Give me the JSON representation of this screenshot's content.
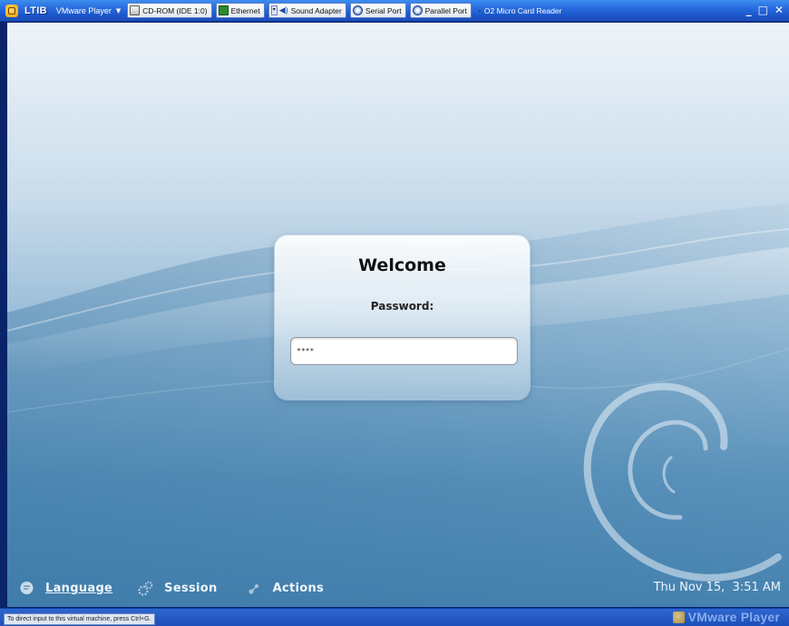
{
  "titlebar": {
    "title": "LTIB",
    "product_menu": "VMware Player",
    "devices": [
      {
        "label": "CD-ROM (IDE 1:0)",
        "icon": "cdrom-icon"
      },
      {
        "label": "Ethernet",
        "icon": "ethernet-icon"
      },
      {
        "label": "Sound Adapter",
        "icon": "sound-icon"
      },
      {
        "label": "Serial Port",
        "icon": "serial-port-icon"
      },
      {
        "label": "Parallel Port",
        "icon": "parallel-port-icon"
      },
      {
        "label": "O2 Micro Card Reader",
        "icon": "card-reader-icon"
      }
    ],
    "window_buttons": {
      "minimize": "_",
      "maximize": "□",
      "close": "✕"
    }
  },
  "login": {
    "title": "Welcome",
    "password_label": "Password:",
    "password_value": "****"
  },
  "menu": {
    "language": "Language",
    "session": "Session",
    "actions": "Actions",
    "clock": "Thu Nov 15,  3:51 AM"
  },
  "statusbar": {
    "hint": "To direct input to this virtual machine, press Ctrl+G.",
    "brand": "VMware Player"
  },
  "colors": {
    "titlebar": "#2a6fe0",
    "desktop_light": "#eef4f9",
    "desktop_dark": "#4783b0"
  }
}
